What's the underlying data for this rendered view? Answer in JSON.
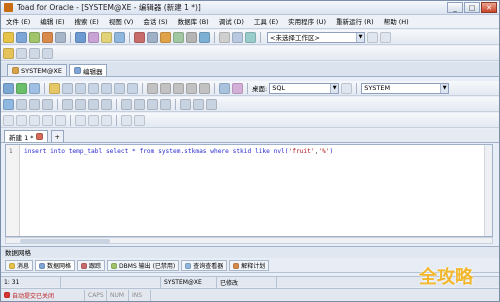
{
  "window": {
    "title": "Toad for Oracle - [SYSTEM@XE - 编辑器 (新建 1 *)]"
  },
  "menu": [
    "文件 (E)",
    "编辑 (E)",
    "搜索 (E)",
    "视图 (V)",
    "会话 (S)",
    "数据库 (B)",
    "调试 (D)",
    "工具 (E)",
    "实用程序 (U)",
    "重新运行 (R)",
    "帮助 (H)"
  ],
  "toolbar1": {
    "schema_select": "<未选择工作区>"
  },
  "conn_tabs": [
    {
      "label": "SYSTEM@XE"
    },
    {
      "label": "编辑器"
    }
  ],
  "toolbar3": {
    "desktop_label": "桌面:",
    "desktop_value": "SQL",
    "schema_value": "SYSTEM"
  },
  "doc_tabs": [
    {
      "label": "新建 1 *"
    }
  ],
  "editor": {
    "line": "1",
    "tokens": [
      {
        "t": "insert into temp_tabl select * from system.stkmas where stkid like nvl(",
        "c": ""
      },
      {
        "t": "'fruit'",
        "c": "str"
      },
      {
        "t": ",",
        "c": "txt"
      },
      {
        "t": "'%'",
        "c": "str"
      },
      {
        "t": ")",
        "c": ""
      }
    ]
  },
  "panel": {
    "title": "数据网格",
    "tabs": [
      "消息",
      "数据网格",
      "跟踪",
      "DBMS 输出 (已禁用)",
      "查询查看器",
      "解释计划"
    ]
  },
  "status": {
    "position": "1: 31",
    "connection": "SYSTEM@XE",
    "modified": "已修改"
  },
  "status2": {
    "autocommit": "自动提交已关闭",
    "caps": "CAPS",
    "num": "NUM",
    "ins": "INS"
  },
  "watermark": "全攻略"
}
